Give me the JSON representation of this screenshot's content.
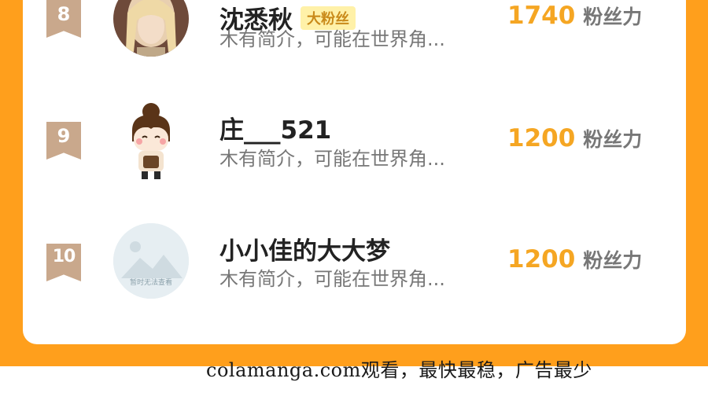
{
  "leaderboard": {
    "unit_label": "粉丝力",
    "rows": [
      {
        "rank": "8",
        "name": "沈悉秋",
        "tag": "大粉丝",
        "intro": "木有简介，可能在世界角...",
        "score": "1740"
      },
      {
        "rank": "9",
        "name": "庄___521",
        "intro": "木有简介，可能在世界角...",
        "score": "1200"
      },
      {
        "rank": "10",
        "name": "小小佳的大大梦",
        "avatar_placeholder_text": "暂时无法查看",
        "intro": "木有简介，可能在世界角...",
        "score": "1200"
      }
    ]
  },
  "footer": {
    "watermark": "colamanga.com观看，最快最稳，广告最少"
  },
  "colors": {
    "frame": "#ff9f1c",
    "score": "#f5a623",
    "badge": "#c9a88c"
  }
}
